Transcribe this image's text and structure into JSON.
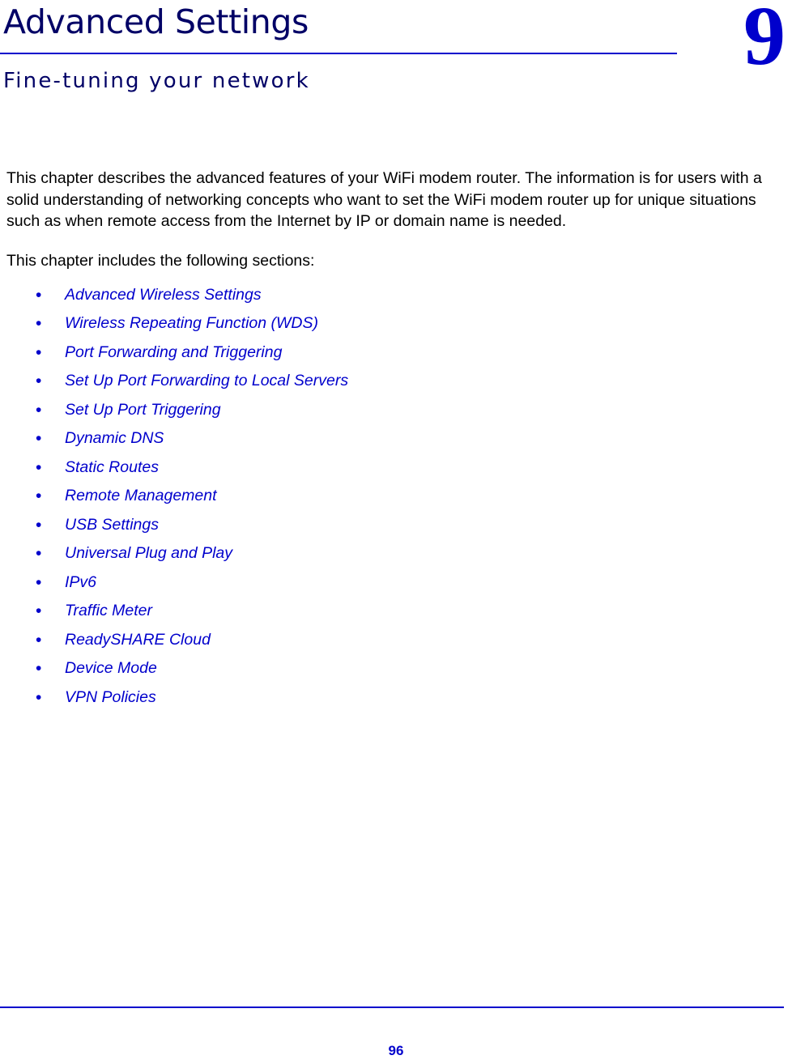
{
  "header": {
    "chapter_title": "Advanced Settings",
    "chapter_subtitle": "Fine-tuning your network",
    "chapter_number": "9",
    "rule_color": "#0000cc",
    "number_color": "#0000cc",
    "title_color": "#000066"
  },
  "body": {
    "intro_paragraph": "This chapter describes the advanced features of your WiFi modem router. The information is for users with a solid understanding of networking concepts who want to set the WiFi modem router up for unique situations such as when remote access from the Internet by IP or domain name is needed.",
    "includes_line": "This chapter includes the following sections:",
    "bullet_glyph": "•",
    "link_color": "#0000cc"
  },
  "sections": [
    {
      "label": "Advanced Wireless Settings"
    },
    {
      "label": "Wireless Repeating Function (WDS)"
    },
    {
      "label": "Port Forwarding and Triggering"
    },
    {
      "label": "Set Up Port Forwarding to Local Servers"
    },
    {
      "label": "Set Up Port Triggering"
    },
    {
      "label": "Dynamic DNS"
    },
    {
      "label": "Static Routes"
    },
    {
      "label": "Remote Management"
    },
    {
      "label": "USB Settings"
    },
    {
      "label": "Universal Plug and Play"
    },
    {
      "label": "IPv6"
    },
    {
      "label": "Traffic Meter"
    },
    {
      "label": "ReadySHARE Cloud"
    },
    {
      "label": "Device Mode"
    },
    {
      "label": "VPN Policies"
    }
  ],
  "footer": {
    "page_number": "96",
    "rule_color": "#0000cc"
  }
}
